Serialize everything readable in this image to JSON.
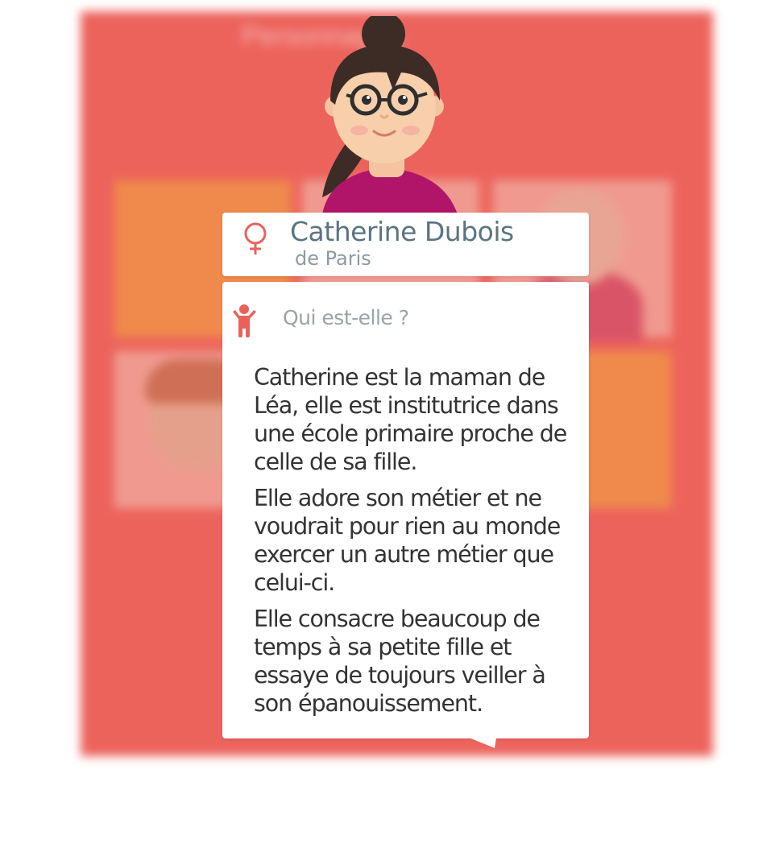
{
  "background": {
    "title": "Personnages",
    "color": "#ec635c"
  },
  "profile": {
    "gender_icon": "female-symbol-icon",
    "name": "Catherine Dubois",
    "city": "de Paris"
  },
  "description": {
    "icon": "child-icon",
    "question": "Qui est-elle ?",
    "paragraphs": [
      "Catherine est la maman de Léa, elle est institutrice dans une école primaire proche de celle de sa fille.",
      "Elle adore son métier et ne voudrait pour rien au monde exercer un autre métier que celui-ci.",
      "Elle consacre beaucoup de temps à sa petite fille et essaye de toujours veiller à son épanouissement."
    ]
  },
  "colors": {
    "accent": "#e8615b",
    "name_text": "#5b7480",
    "body_text": "#333333"
  }
}
